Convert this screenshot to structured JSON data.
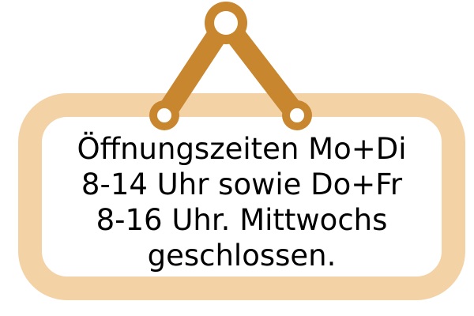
{
  "sign": {
    "lines": [
      "Öffnungszeiten Mo+Di",
      "8-14 Uhr sowie Do+Fr",
      "8-16 Uhr. Mittwochs",
      "geschlossen."
    ]
  },
  "colors": {
    "frame": "#f3d2a5",
    "hanger": "#c8862f",
    "panel": "#ffffff",
    "text": "#000000"
  },
  "icons": {
    "hanger": "hanger-icon"
  }
}
